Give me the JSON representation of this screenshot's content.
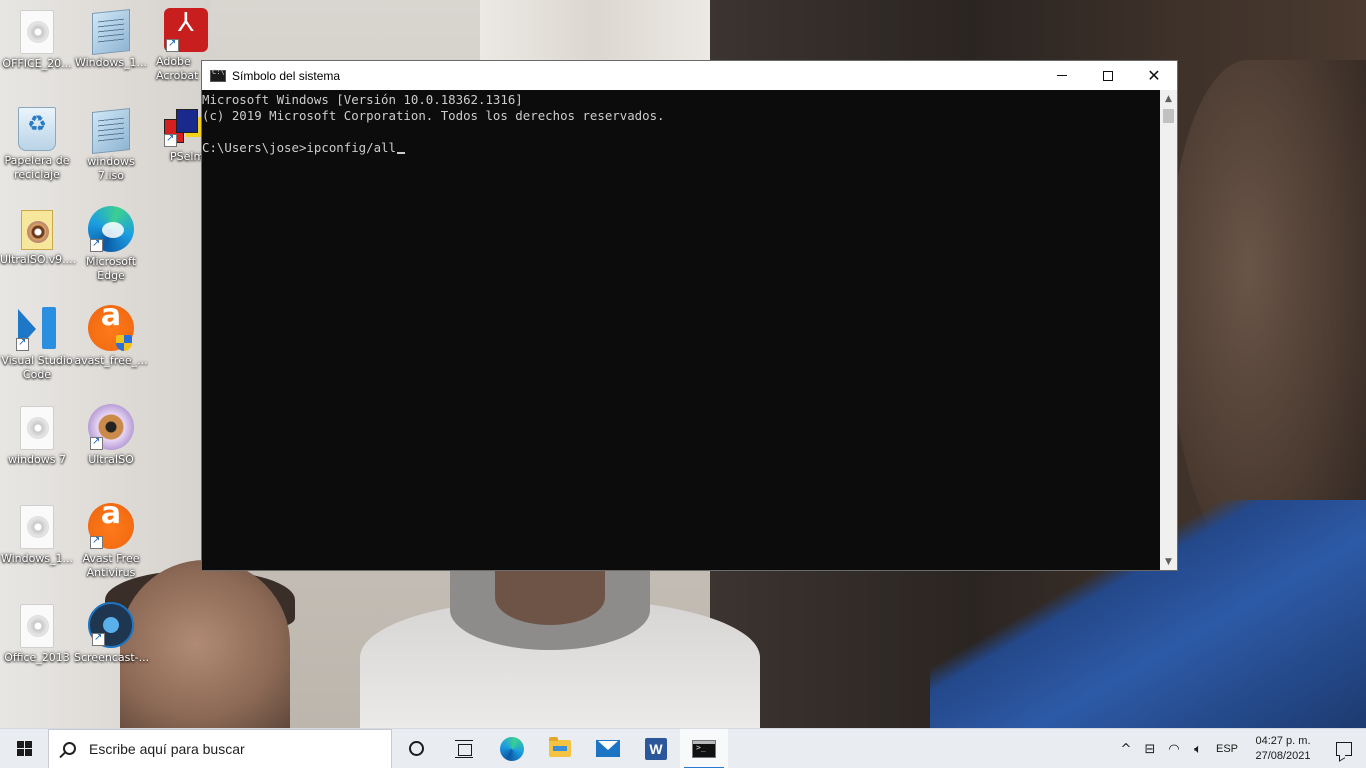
{
  "desktop": {
    "icons": [
      {
        "label": "OFFICE_20...",
        "icon": "disc-image-icon"
      },
      {
        "label": "Windows_1...",
        "icon": "notepad-file-icon"
      },
      {
        "label": "Adobe Acrobat",
        "icon": "adobe-acrobat-icon"
      },
      {
        "label": "Papelera de reciclaje",
        "icon": "recycle-bin-icon"
      },
      {
        "label": "windows 7.iso",
        "icon": "notepad-file-icon"
      },
      {
        "label": "PSelm",
        "icon": "pselm-icon"
      },
      {
        "label": "UltraISO.v9....",
        "icon": "ultraiso-file-icon"
      },
      {
        "label": "Microsoft Edge",
        "icon": "edge-icon"
      },
      {
        "label": "Visual Studio Code",
        "icon": "vscode-icon"
      },
      {
        "label": "avast_free_...",
        "icon": "avast-installer-icon"
      },
      {
        "label": "windows 7",
        "icon": "disc-image-icon"
      },
      {
        "label": "UltraISO",
        "icon": "ultraiso-icon"
      },
      {
        "label": "Windows_1...",
        "icon": "disc-image-icon"
      },
      {
        "label": "Avast Free Antivirus",
        "icon": "avast-icon"
      },
      {
        "label": "Office_2013",
        "icon": "disc-image-icon"
      },
      {
        "label": "Screencast-...",
        "icon": "screencast-icon"
      }
    ]
  },
  "cmd": {
    "title": "Símbolo del sistema",
    "lines": [
      "Microsoft Windows [Versión 10.0.18362.1316]",
      "(c) 2019 Microsoft Corporation. Todos los derechos reservados.",
      "",
      "C:\\Users\\jose>ipconfig/all"
    ],
    "buttons": {
      "minimize": "minimize-icon",
      "maximize": "maximize-icon",
      "close": "✕"
    }
  },
  "taskbar": {
    "search_placeholder": "Escribe aquí para buscar",
    "apps": [
      "cortana-icon",
      "task-view-icon",
      "edge-icon",
      "file-explorer-icon",
      "mail-icon",
      "word-icon",
      "cmd-icon"
    ],
    "tray": {
      "chevron": "^",
      "language": "ESP",
      "time": "04:27 p. m.",
      "date": "27/08/2021"
    }
  },
  "colors": {
    "console_bg": "#0c0c0c",
    "console_fg": "#cccccc",
    "taskbar_bg": "#e9ecf1",
    "accent": "#2b79d6"
  }
}
